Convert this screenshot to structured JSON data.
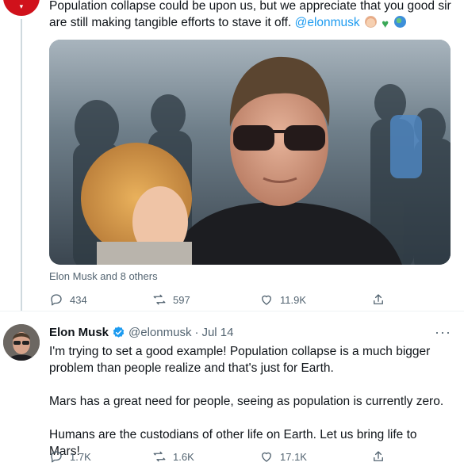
{
  "first_tweet": {
    "avatar_logo_icon": "brand-logo-icon",
    "text": "Population collapse could be upon us, but we appreciate that you good sir are still making tangible efforts to stave it off.",
    "mention": "@elonmusk",
    "emojis": [
      "baby-face",
      "green-heart",
      "globe"
    ],
    "photo_description_icon": "photo",
    "tagged_people": "Elon Musk and 8 others",
    "reply_count": "434",
    "retweet_count": "597",
    "like_count": "11.9K"
  },
  "second_tweet": {
    "author_name": "Elon Musk",
    "handle": "@elonmusk",
    "separator": "·",
    "date": "Jul 14",
    "more_icon": "···",
    "paragraphs": [
      "I'm trying to set a good example! Population collapse is a much bigger problem than people realize and that's just for Earth.",
      "Mars has a great need for people, seeing as population is currently zero.",
      "Humans are the custodians of other life on Earth. Let us bring life to Mars!"
    ],
    "reply_count": "1.7K",
    "retweet_count": "1.6K",
    "like_count": "17.1K"
  },
  "colors": {
    "accent": "#1d9bf0",
    "secondary_text": "#536471",
    "primary_text": "#0f1419",
    "brand_red": "#d0111b"
  }
}
